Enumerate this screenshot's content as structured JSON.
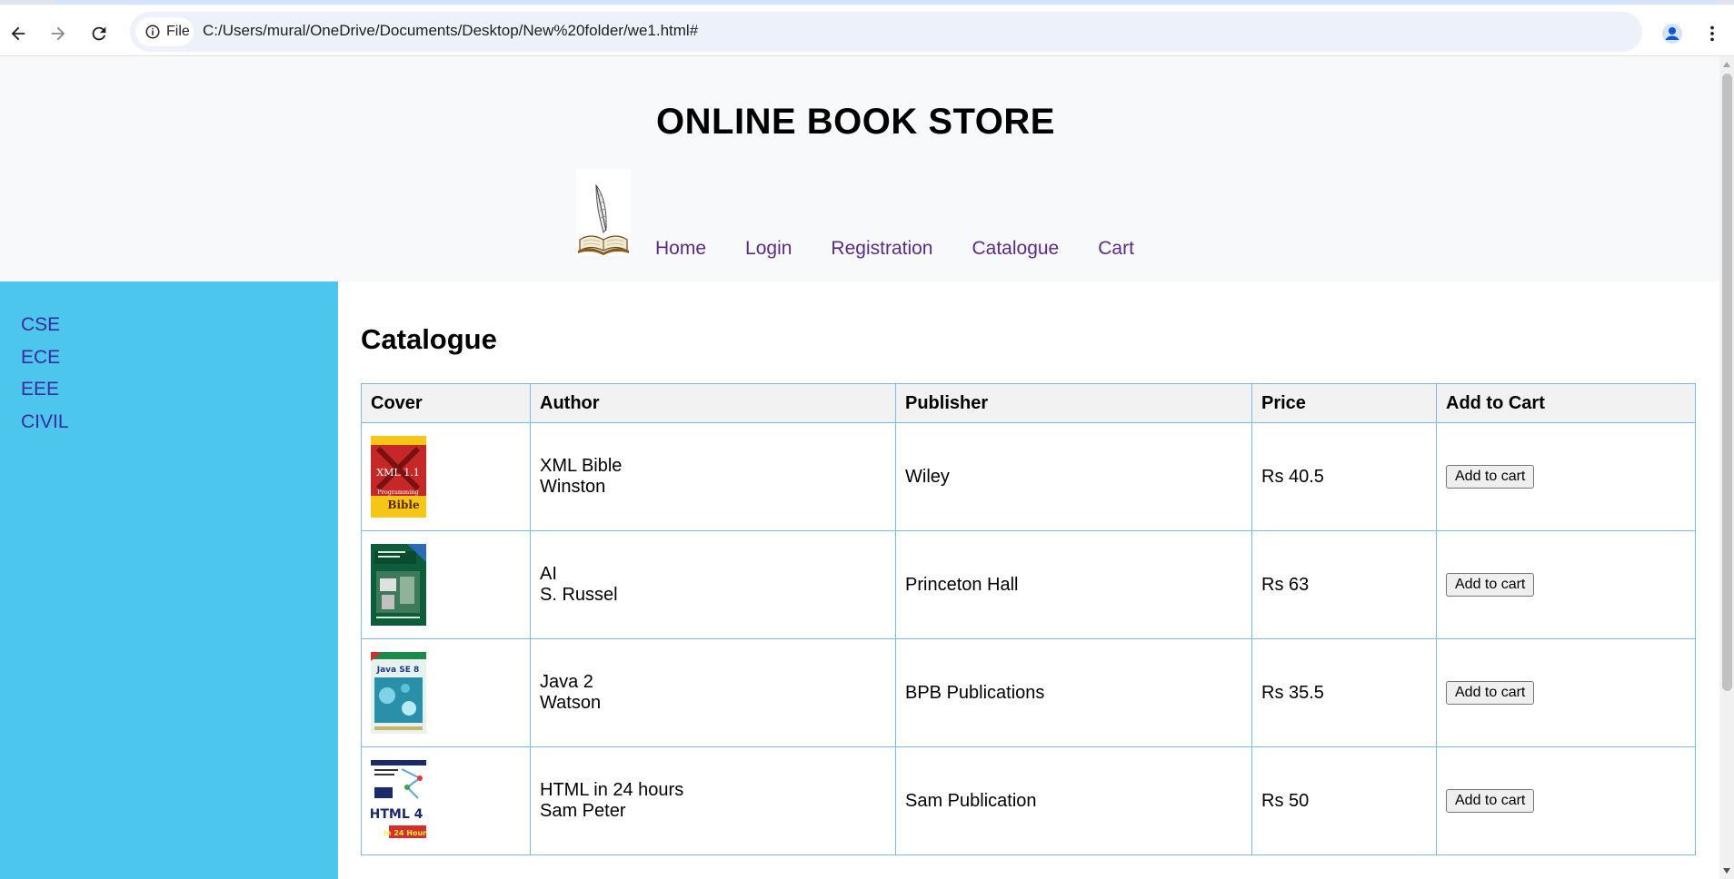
{
  "browser": {
    "site_chip_label": "File",
    "url": "C:/Users/mural/OneDrive/Documents/Desktop/New%20folder/we1.html#",
    "icons": [
      "back-arrow-icon",
      "forward-arrow-icon",
      "reload-icon",
      "info-icon",
      "star-icon",
      "profile-icon",
      "more-vert-icon"
    ]
  },
  "header": {
    "title": "ONLINE BOOK STORE",
    "nav": [
      {
        "label": "Home"
      },
      {
        "label": "Login"
      },
      {
        "label": "Registration"
      },
      {
        "label": "Catalogue"
      },
      {
        "label": "Cart"
      }
    ]
  },
  "sidebar": {
    "items": [
      {
        "label": "CSE"
      },
      {
        "label": "ECE"
      },
      {
        "label": "EEE"
      },
      {
        "label": "CIVIL"
      }
    ]
  },
  "main": {
    "heading": "Catalogue",
    "columns": [
      "Cover",
      "Author",
      "Publisher",
      "Price",
      "Add to Cart"
    ],
    "rows": [
      {
        "title": "XML Bible",
        "author": "Winston",
        "publisher": "Wiley",
        "price": "Rs 40.5",
        "button": "Add to cart",
        "cover_icon": "xml-bible-cover-icon"
      },
      {
        "title": "AI",
        "author": "S. Russel",
        "publisher": "Princeton Hall",
        "price": "Rs 63",
        "button": "Add to cart",
        "cover_icon": "ai-book-cover-icon"
      },
      {
        "title": "Java 2",
        "author": "Watson",
        "publisher": "BPB Publications",
        "price": "Rs 35.5",
        "button": "Add to cart",
        "cover_icon": "java-book-cover-icon"
      },
      {
        "title": "HTML in 24 hours",
        "author": "Sam Peter",
        "publisher": "Sam Publication",
        "price": "Rs 50",
        "button": "Add to cart",
        "cover_icon": "html-book-cover-icon"
      }
    ],
    "cover_texts": {
      "xml": [
        "XML 1.1",
        "Programming",
        "Bible"
      ],
      "java": "Java SE 8",
      "html": [
        "HTML 4",
        "in 24 Hours"
      ]
    }
  },
  "colors": {
    "sidebar_bg": "#4dc6ee",
    "header_bg": "#f8f9fa",
    "link_purple": "#5b2a86",
    "table_border": "#7fb8e6"
  }
}
